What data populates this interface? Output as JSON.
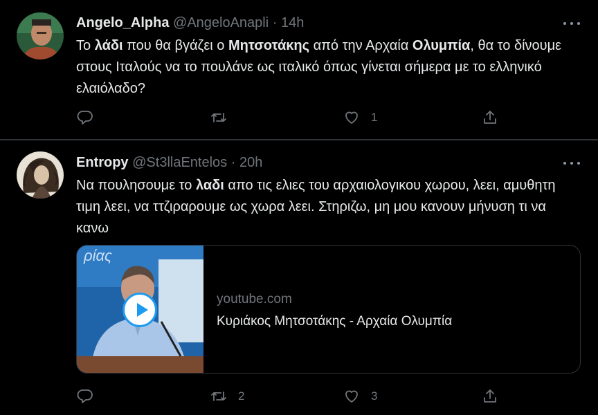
{
  "tweets": [
    {
      "name": "Angelo_Alpha",
      "handle": "@AngeloAnapli",
      "separator": "·",
      "time": "14h",
      "text": [
        "Το ",
        "λάδι",
        " που θα βγάζει ο ",
        "Μητσοτάκης",
        " από την Αρχαία ",
        "Ολυμπία",
        ", θα το δίνουμε στους Ιταλούς να το πουλάνε ως ιταλικό όπως γίνεται σήμερα με το ελληνικό ελαιόλαδο?"
      ],
      "actions": {
        "reply_count": "",
        "retweet_count": "",
        "like_count": "1"
      }
    },
    {
      "name": "Entropy",
      "handle": "@St3llaEntelos",
      "separator": "·",
      "time": "20h",
      "text": [
        "Να πουλησουμε το ",
        "λαδι",
        " απο τις ελιες του αρχαιολογικου χωρου, λεει, αμυθητη τιμη λεει, να ττζιραρουμε ως χωρα λεει. Στηριζω, μη μου κανουν μήνυση τι να κανω"
      ],
      "card": {
        "domain": "youtube.com",
        "title": "Κυριάκος Μητσοτάκης - Αρχαία Ολυμπία",
        "thumbnail_text": "ρίας",
        "icon": "play-icon"
      },
      "actions": {
        "reply_count": "",
        "retweet_count": "2",
        "like_count": "3"
      }
    }
  ],
  "icons": {
    "more": "more-icon",
    "reply": "reply-icon",
    "retweet": "retweet-icon",
    "like": "like-icon",
    "share": "share-icon"
  },
  "colors": {
    "background": "#000000",
    "text": "#e7e9ea",
    "muted": "#71767b",
    "accent": "#1d9bf0",
    "border": "#2f3336"
  }
}
